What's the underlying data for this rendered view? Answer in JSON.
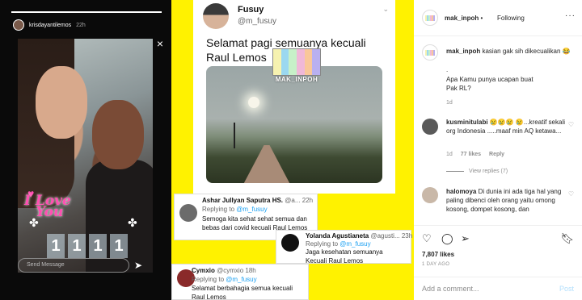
{
  "story": {
    "username": "krisdayantilemos",
    "time": "22h",
    "close_icon": "×",
    "sticker_love": "I Love",
    "sticker_you": "You",
    "digits": [
      "1",
      "1",
      "1",
      "1"
    ],
    "send_placeholder": "Send Message",
    "progress": 1.0
  },
  "tweet": {
    "name": "Fusuy",
    "handle": "@m_fusuy",
    "text": "Selamat pagi semuanya kecuali Raul Lemos",
    "watermark": "MAK_INPOH",
    "watermark_colors": [
      "#f6f2b0",
      "#9bd8f0",
      "#c7f0c8",
      "#f0b8d8",
      "#f9c79a",
      "#b9b0f0"
    ]
  },
  "replies": [
    {
      "name": "Ashar Jullyan Saputra HS.",
      "handle": "@a...",
      "time": "22h",
      "replying_label": "Replying to",
      "mention": "@m_fusuy",
      "text": "Semoga kita sehat sehat semua dan bebas dari covid kecuali Raul Lemos",
      "avatar_color": "#6b6b6b"
    },
    {
      "name": "Yolanda Agustianeta",
      "handle": "@agusti...",
      "time": "23h",
      "replying_label": "Replying to",
      "mention": "@m_fusuy",
      "text": "Jaga kesehatan semuanya Kecuali Raul Lemos",
      "avatar_color": "#111111"
    },
    {
      "name": "Cymxio",
      "handle": "@cymxio",
      "time": "18h",
      "replying_label": "Replying to",
      "mention": "@m_fusuy",
      "text": "Selamat berbahagia semua kecuali Raul Lemos",
      "avatar_color": "#8a2a2a"
    }
  ],
  "instagram": {
    "header": {
      "username": "mak_inpoh",
      "separator": "•",
      "follow_state": "Following",
      "more_icon": "···"
    },
    "caption": {
      "username": "mak_inpoh",
      "text": "kasian gak sih dikecualikan 😂",
      "dot": ".",
      "question": "Apa Kamu punya ucapan buat Pak RL?",
      "age": "1d"
    },
    "comments": [
      {
        "username": "kusminitulabi",
        "text": "😢😢😢 😢...kreatif sekali org Indonesia .....maaf min AQ ketawa...",
        "age": "1d",
        "likes": "77 likes",
        "reply": "Reply",
        "view_replies": "View replies (7)",
        "avatar_color": "#5a5a5a"
      },
      {
        "username": "halomoya",
        "text": "Di dunia ini ada tiga hal yang paling dibenci oleh orang yaitu omong kosong, dompet kosong, dan",
        "avatar_color": "#c9b8a8"
      }
    ],
    "likes": "7,807 likes",
    "posted": "1 DAY AGO",
    "add_comment_placeholder": "Add a comment...",
    "post_label": "Post"
  }
}
